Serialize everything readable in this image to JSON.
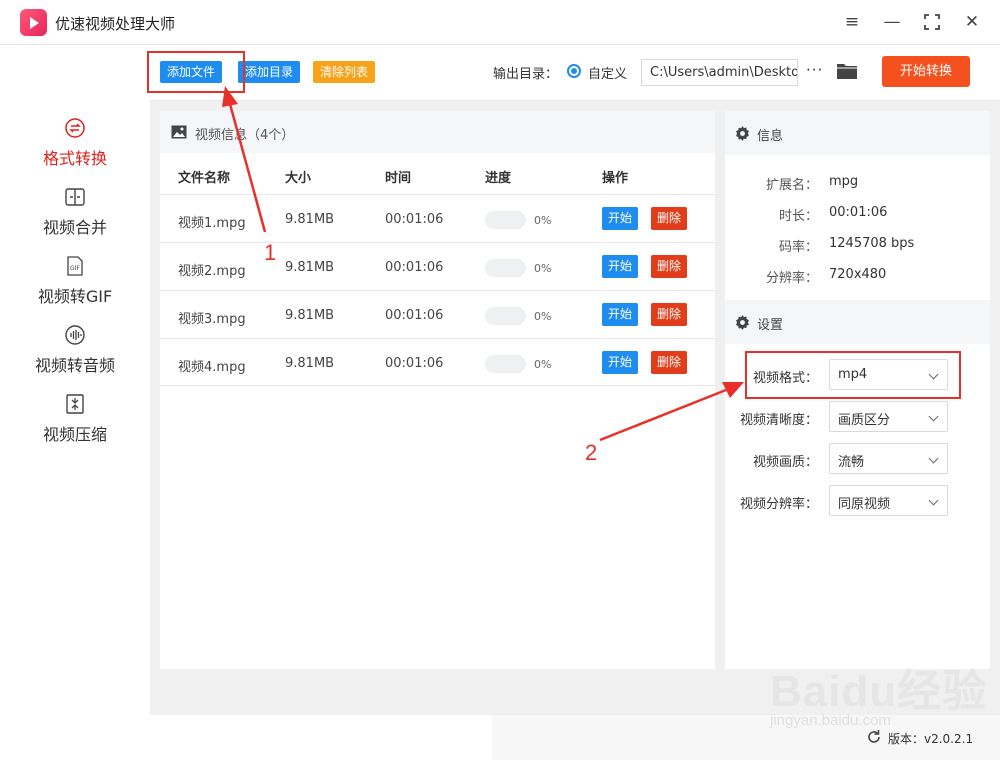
{
  "app": {
    "title": "优速视频处理大师",
    "accent": "#1f8cf0"
  },
  "window_controls": [
    "menu-icon",
    "minimize-icon",
    "maximize-icon",
    "close-icon"
  ],
  "sidebar": {
    "items": [
      {
        "label": "格式转换",
        "icon": "convert-icon",
        "active": true
      },
      {
        "label": "视频合并",
        "icon": "merge-icon",
        "active": false
      },
      {
        "label": "视频转GIF",
        "icon": "gif-icon",
        "active": false
      },
      {
        "label": "视频转音频",
        "icon": "audio-icon",
        "active": false
      },
      {
        "label": "视频压缩",
        "icon": "compress-icon",
        "active": false
      }
    ]
  },
  "toolbar": {
    "add_file": "添加文件",
    "add_dir": "添加目录",
    "clear_list": "清除列表",
    "output_label": "输出目录：",
    "radio_label": "自定义",
    "output_path": "C:\\Users\\admin\\Desktop",
    "more": "···",
    "start_convert": "开始转换"
  },
  "file_panel": {
    "title": "视频信息（4个）",
    "columns": [
      "文件名称",
      "大小",
      "时间",
      "进度",
      "操作"
    ],
    "rows": [
      {
        "name": "视频1.mpg",
        "size": "9.81MB",
        "time": "00:01:06",
        "progress": 0,
        "progress_text": "0%",
        "start": "开始",
        "delete": "删除"
      },
      {
        "name": "视频2.mpg",
        "size": "9.81MB",
        "time": "00:01:06",
        "progress": 0,
        "progress_text": "0%",
        "start": "开始",
        "delete": "删除"
      },
      {
        "name": "视频3.mpg",
        "size": "9.81MB",
        "time": "00:01:06",
        "progress": 0,
        "progress_text": "0%",
        "start": "开始",
        "delete": "删除"
      },
      {
        "name": "视频4.mpg",
        "size": "9.81MB",
        "time": "00:01:06",
        "progress": 0,
        "progress_text": "0%",
        "start": "开始",
        "delete": "删除"
      }
    ]
  },
  "info": {
    "title": "信息",
    "fields": [
      {
        "key": "扩展名：",
        "value": "mpg"
      },
      {
        "key": "时长：",
        "value": "00:01:06"
      },
      {
        "key": "码率：",
        "value": "1245708 bps"
      },
      {
        "key": "分辨率：",
        "value": "720x480"
      }
    ]
  },
  "settings": {
    "title": "设置",
    "fields": [
      {
        "key": "视频格式：",
        "value": "mp4"
      },
      {
        "key": "视频清晰度：",
        "value": "画质区分"
      },
      {
        "key": "视频画质：",
        "value": "流畅"
      },
      {
        "key": "视频分辨率：",
        "value": "同原视频"
      }
    ]
  },
  "status": {
    "version": "版本：v2.0.2.1"
  },
  "annotations": {
    "label1": "1",
    "label2": "2",
    "color": "#e8302a"
  },
  "watermark": {
    "text": "Baidu经验",
    "url": "jingyan.baidu.com"
  }
}
